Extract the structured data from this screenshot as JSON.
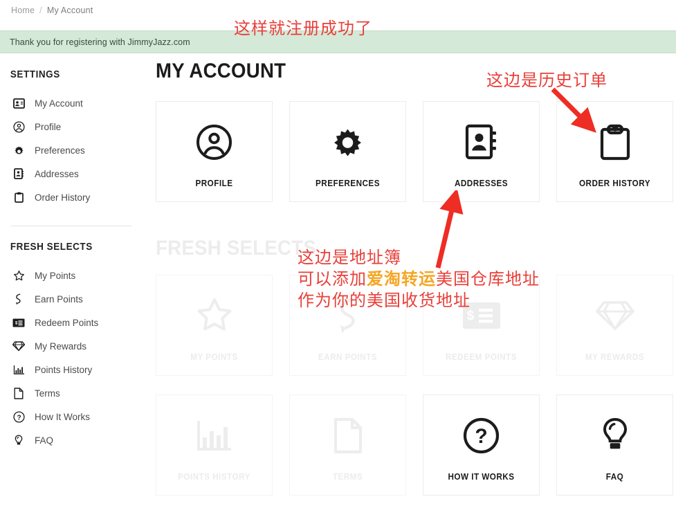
{
  "breadcrumb": {
    "home": "Home",
    "separator": "/",
    "current": "My Account"
  },
  "banner": {
    "message": "Thank you for registering with JimmyJazz.com",
    "bg_color": "#d4e9d7"
  },
  "sidebar": {
    "sections": [
      {
        "heading": "SETTINGS",
        "items": [
          {
            "label": "My Account",
            "icon": "contact-card-icon"
          },
          {
            "label": "Profile",
            "icon": "user-circle-icon"
          },
          {
            "label": "Preferences",
            "icon": "gear-icon"
          },
          {
            "label": "Addresses",
            "icon": "address-book-icon"
          },
          {
            "label": "Order History",
            "icon": "clipboard-icon"
          }
        ]
      },
      {
        "heading": "FRESH SELECTS",
        "items": [
          {
            "label": "My Points",
            "icon": "star-icon"
          },
          {
            "label": "Earn Points",
            "icon": "ribbon-icon"
          },
          {
            "label": "Redeem Points",
            "icon": "money-card-icon"
          },
          {
            "label": "My Rewards",
            "icon": "diamond-icon"
          },
          {
            "label": "Points History",
            "icon": "bar-chart-icon"
          },
          {
            "label": "Terms",
            "icon": "document-icon"
          },
          {
            "label": "How It Works",
            "icon": "question-circle-icon"
          },
          {
            "label": "FAQ",
            "icon": "lightbulb-icon"
          }
        ]
      }
    ]
  },
  "main": {
    "page_title": "MY ACCOUNT",
    "section_title": "FRESH SELECTS",
    "account_cards": [
      {
        "label": "PROFILE",
        "icon": "user-circle-icon",
        "disabled": false
      },
      {
        "label": "PREFERENCES",
        "icon": "gear-icon",
        "disabled": false
      },
      {
        "label": "ADDRESSES",
        "icon": "address-book-icon",
        "disabled": false
      },
      {
        "label": "ORDER HISTORY",
        "icon": "clipboard-icon",
        "disabled": false
      }
    ],
    "fresh_cards_row1": [
      {
        "label": "MY POINTS",
        "icon": "star-icon",
        "disabled": true
      },
      {
        "label": "EARN POINTS",
        "icon": "ribbon-icon",
        "disabled": true
      },
      {
        "label": "REDEEM POINTS",
        "icon": "money-card-icon",
        "disabled": true
      },
      {
        "label": "MY REWARDS",
        "icon": "diamond-icon",
        "disabled": true
      }
    ],
    "fresh_cards_row2": [
      {
        "label": "POINTS HISTORY",
        "icon": "bar-chart-icon",
        "disabled": true
      },
      {
        "label": "TERMS",
        "icon": "document-icon",
        "disabled": true
      },
      {
        "label": "HOW IT WORKS",
        "icon": "question-circle-icon",
        "disabled": false
      },
      {
        "label": "FAQ",
        "icon": "lightbulb-icon",
        "disabled": false
      }
    ]
  },
  "annotations": {
    "color": "#e8403a",
    "highlight_color": "#f5a623",
    "register": "这样就注册成功了",
    "order_history": "这边是历史订单",
    "address_line1": "这边是地址簿",
    "address_line2_a": "可以添加",
    "address_line2_hl": "爱淘转运",
    "address_line2_b": "美国仓库地址",
    "address_line3": "作为你的美国收货地址"
  }
}
